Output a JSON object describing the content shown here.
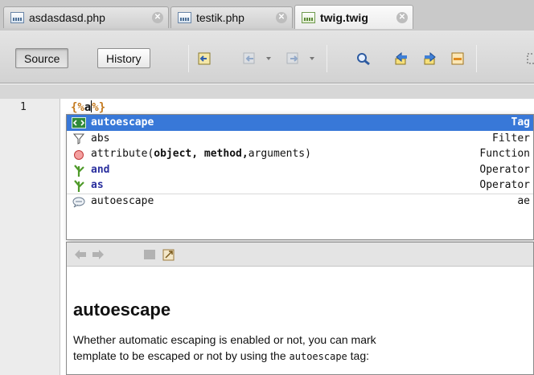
{
  "tabs": [
    {
      "label": "asdasdasd.php",
      "active": false
    },
    {
      "label": "testik.php",
      "active": false
    },
    {
      "label": "twig.twig",
      "active": true
    }
  ],
  "toolbar": {
    "source_label": "Source",
    "history_label": "History",
    "icons": [
      "last-edit-icon",
      "back-icon",
      "forward-icon",
      "find-selection-icon",
      "find-previous-icon",
      "find-next-icon",
      "toggle-highlight-icon"
    ]
  },
  "editor": {
    "line_number": "1",
    "open_delim": "{%",
    "typed": "a",
    "close_delim": "%}"
  },
  "completion": {
    "items": [
      {
        "name": "autoescape",
        "kind": "Tag",
        "icon": "tag-icon",
        "selected": true
      },
      {
        "name": "abs",
        "kind": "Filter",
        "icon": "filter-icon",
        "selected": false
      },
      {
        "name": "attribute(",
        "bold_args": "object, method,",
        "rest": " arguments)",
        "kind": "Function",
        "icon": "function-icon",
        "selected": false
      },
      {
        "name": "and",
        "kind": "Operator",
        "icon": "operator-icon",
        "selected": false
      },
      {
        "name": "as",
        "kind": "Operator",
        "icon": "operator-icon",
        "selected": false
      },
      {
        "name": "autoescape",
        "kind": "ae",
        "icon": "code-template-icon",
        "selected": false
      }
    ]
  },
  "docs": {
    "title": "autoescape",
    "body_before": "Whether automatic escaping is enabled or not, you can mark",
    "body_line2_before": "template to be escaped or not by using the ",
    "body_code": "autoescape",
    "body_after": " tag:"
  },
  "colors": {
    "selection": "#3878d8",
    "delimiter": "#c47a1f"
  }
}
